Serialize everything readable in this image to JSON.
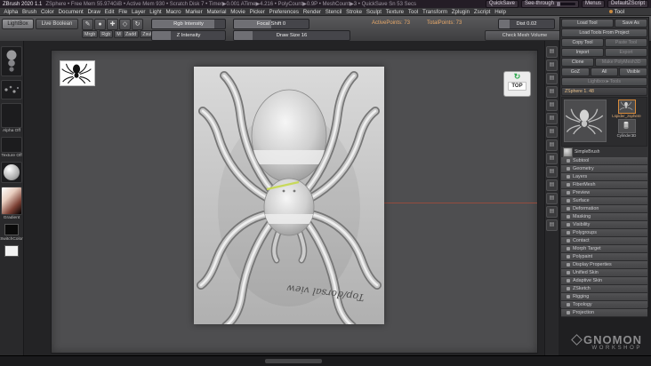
{
  "titlebar": {
    "app": "ZBrush 2020 1.1",
    "stats": "ZSphere • Free Mem 55.974GiB • Active Mem 930 • Scratch Disk 7 • Timer▶0.001 ATime▶4.216 • PolyCount▶0.9P • MeshCount▶3 • QuickSave Sn 53 Secs",
    "quicksave": "QuickSave",
    "see_through": "See-through",
    "menus": "Menus",
    "default_zscript": "DefaultZScript"
  },
  "menubar": {
    "items": [
      "Alpha",
      "Brush",
      "Color",
      "Document",
      "Draw",
      "Edit",
      "File",
      "Layer",
      "Light",
      "Macro",
      "Marker",
      "Material",
      "Movie",
      "Picker",
      "Preferences",
      "Render",
      "Stencil",
      "Stroke",
      "Sculpt",
      "Texture",
      "Tool",
      "Transform",
      "Zplugin",
      "Zscript",
      "Help"
    ],
    "right": "Tool"
  },
  "toolbar": {
    "lightbox": "LightBox",
    "live_boolean": "Live Boolean",
    "icon_glyphs": [
      "✎",
      "●",
      "✚",
      "◇",
      "↻"
    ],
    "modes": [
      "Mrgb",
      "Rgb",
      "M"
    ],
    "zmodes": [
      "Zadd",
      "Zsub"
    ],
    "rgb_intensity": "Rgb Intensity",
    "z_intensity": "Z Intensity",
    "focal_shift": "Focal Shift 0",
    "draw_size": "Draw Size 16",
    "active_points": "ActivePoints: 73",
    "total_points": "TotalPoints: 73",
    "dist": "Dist 0.02",
    "check_mesh_volume": "Check Mesh Volume"
  },
  "left_tray": {
    "alpha_label": "Alpha Off",
    "texture_label": "Texture Off",
    "gradient_label": "Gradient",
    "switch_label": "SwitchColor"
  },
  "canvas": {
    "gizmo": "TOP",
    "annotation": "Top/dorsal view"
  },
  "dock_icons": [
    "▤",
    "▤",
    "▤",
    "▤",
    "▤",
    "▤",
    "▤",
    "▤",
    "▤",
    "▤",
    "▤",
    "▤",
    "▤",
    "▤"
  ],
  "right_panel": {
    "title": "Tool",
    "buttons": {
      "load_tool": "Load Tool",
      "save_as": "Save As",
      "load_tools_from_project": "Load Tools From Project",
      "copy_tool": "Copy Tool",
      "paste_tool": "Paste Tool",
      "import": "Import",
      "export": "Export",
      "clone": "Clone",
      "make_polymesh3d": "Make PolyMesh3D",
      "goz": "GoZ",
      "all": "All",
      "visible": "Visible",
      "lightbox_tools": "Lightbox►Tools",
      "active_tool": "ZSphere 1. 48"
    },
    "thumbnails": {
      "current_label": "Lspider_zsphere",
      "cylinder_label": "Cylinder3D",
      "brush_label": "SimpleBrush"
    },
    "subpalettes": [
      "Subtool",
      "Geometry",
      "Layers",
      "FiberMesh",
      "Preview",
      "Surface",
      "Deformation",
      "Masking",
      "Visibility",
      "Polygroups",
      "Contact",
      "Morph Target",
      "Polypaint",
      "Display Properties",
      "Unified Skin",
      "Adaptive Skin",
      "ZSketch",
      "Rigging",
      "Topology",
      "Projection"
    ]
  },
  "watermark": {
    "name": "GNOMON",
    "sub": "WORKSHOP"
  },
  "colors": {
    "accent_orange": "#e8a96a",
    "gizmo_green": "#2fa84f",
    "red_line": "#a84c3a"
  }
}
